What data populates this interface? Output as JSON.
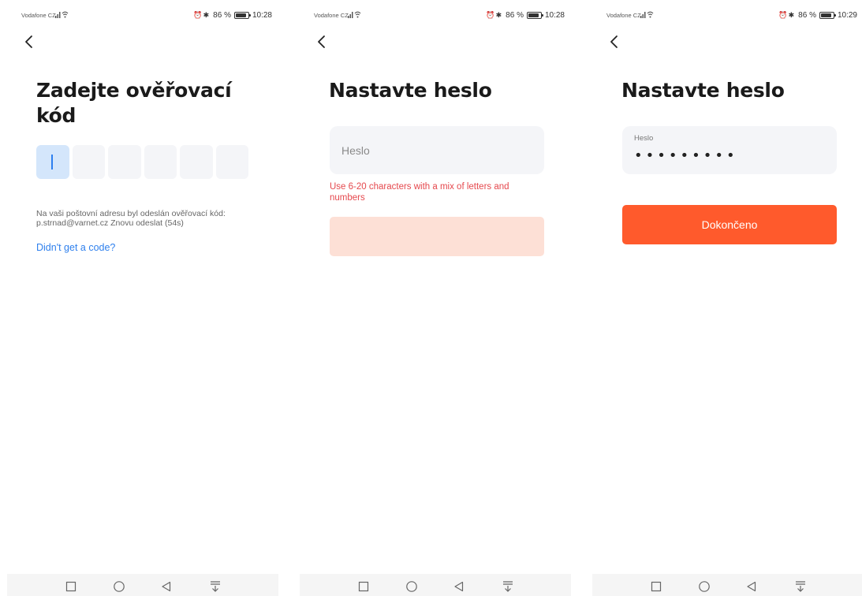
{
  "status": [
    {
      "carrier": "Vodafone CZ",
      "battery": "86 %",
      "time": "10:28"
    },
    {
      "carrier": "Vodafone CZ",
      "battery": "86 %",
      "time": "10:28"
    },
    {
      "carrier": "Vodafone CZ",
      "battery": "86 %",
      "time": "10:29"
    }
  ],
  "screen1": {
    "title": "Zadejte ověřovací kód",
    "code_boxes": 6,
    "info_text": "Na vaši poštovní adresu byl odeslán ověřovací kód: p.strnad@varnet.cz Znovu odeslat (54s)",
    "link": "Didn't get a code?"
  },
  "screen2": {
    "title": "Nastavte heslo",
    "placeholder": "Heslo",
    "error": "Use 6-20 characters with a mix of letters and numbers"
  },
  "screen3": {
    "title": "Nastavte heslo",
    "field_label": "Heslo",
    "field_value": "•••••••••",
    "button": "Dokončeno"
  },
  "colors": {
    "accent": "#ff5a2c",
    "accent_disabled": "#fde0d6",
    "error": "#e5484d",
    "link": "#2f80ed",
    "code_active": "#d4e6fb",
    "field_bg": "#f4f5f8"
  },
  "nav_icons": [
    "recent-apps-icon",
    "home-icon",
    "back-icon",
    "notification-pulldown-icon"
  ]
}
